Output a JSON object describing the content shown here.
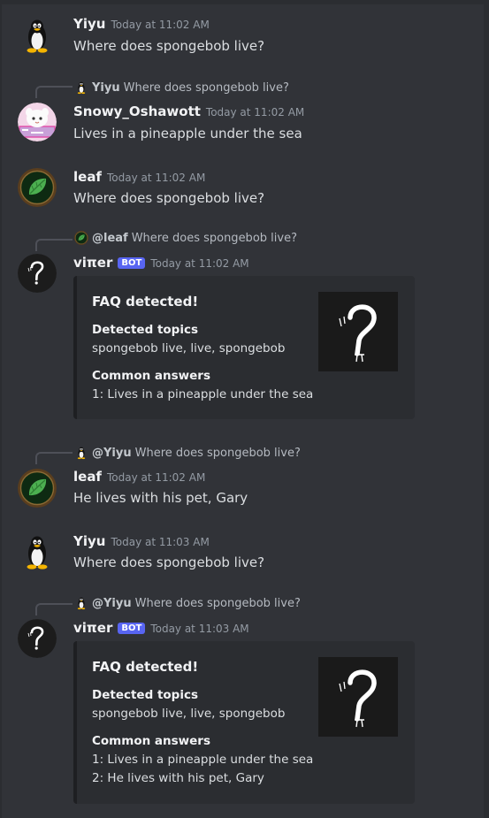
{
  "messages": [
    {
      "author": "Yiyu",
      "timestamp": "Today at 11:02 AM",
      "text": "Where does spongebob live?",
      "avatar_icon": "tux-penguin-icon"
    },
    {
      "reply_to": {
        "author": "Yiyu",
        "text": "Where does spongebob live?"
      },
      "author": "Snowy_Oshawott",
      "timestamp": "Today at 11:02 AM",
      "text": "Lives in a pineapple under the sea",
      "avatar_icon": "oshawott-avatar"
    },
    {
      "author": "leaf",
      "timestamp": "Today at 11:02 AM",
      "text": "Where does spongebob live?",
      "avatar_icon": "leaf-icon"
    },
    {
      "reply_to": {
        "author": "@leaf",
        "text": "Where does spongebob live?"
      },
      "author": "viπer",
      "badge": "BOT",
      "timestamp": "Today at 11:02 AM",
      "avatar_icon": "question-mark-pi-icon",
      "embed": {
        "title": "FAQ detected!",
        "fields": [
          {
            "name": "Detected topics",
            "value": "spongebob live, live, spongebob"
          },
          {
            "name": "Common answers",
            "value": "1: Lives in a pineapple under the sea"
          }
        ]
      }
    },
    {
      "reply_to": {
        "author": "@Yiyu",
        "text": "Where does spongebob live?"
      },
      "author": "leaf",
      "timestamp": "Today at 11:02 AM",
      "text": "He lives with his pet, Gary",
      "avatar_icon": "leaf-icon"
    },
    {
      "author": "Yiyu",
      "timestamp": "Today at 11:03 AM",
      "text": "Where does spongebob live?",
      "avatar_icon": "tux-penguin-icon"
    },
    {
      "reply_to": {
        "author": "@Yiyu",
        "text": "Where does spongebob live?"
      },
      "author": "viπer",
      "badge": "BOT",
      "timestamp": "Today at 11:03 AM",
      "avatar_icon": "question-mark-pi-icon",
      "embed": {
        "title": "FAQ detected!",
        "fields": [
          {
            "name": "Detected topics",
            "value": "spongebob live, live, spongebob"
          },
          {
            "name": "Common answers",
            "value": "1: Lives in a pineapple under the sea",
            "value2": "2: He lives with his pet, Gary"
          }
        ]
      }
    }
  ],
  "colors": {
    "background": "#313338",
    "embed_bg": "#2b2d31",
    "bot_badge": "#5865f2",
    "username": "#f2f3f5",
    "timestamp": "#949ba4"
  }
}
